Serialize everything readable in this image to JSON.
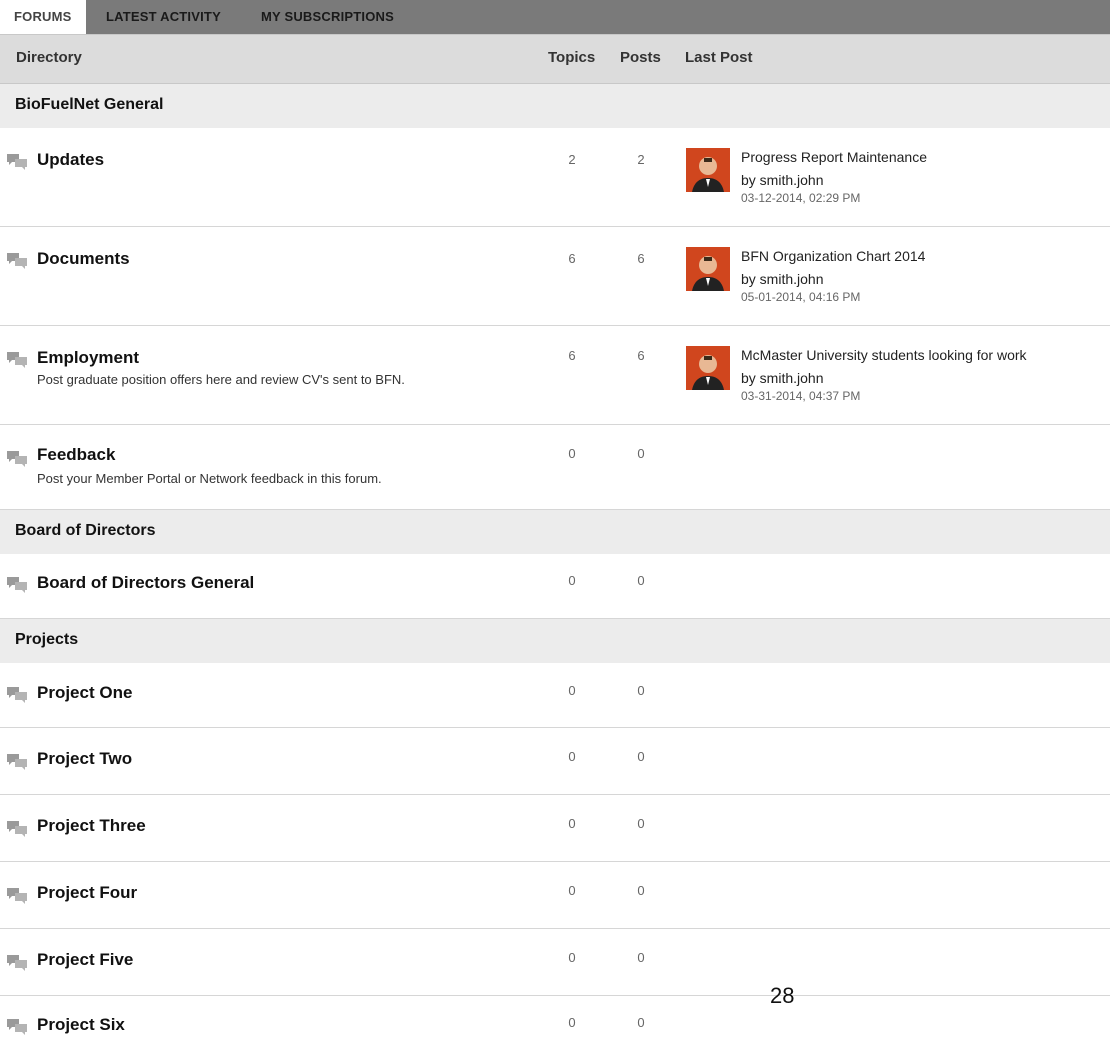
{
  "tabs": [
    "FORUMS",
    "LATEST ACTIVITY",
    "MY SUBSCRIPTIONS"
  ],
  "columns": {
    "directory": "Directory",
    "topics": "Topics",
    "posts": "Posts",
    "last_post": "Last Post"
  },
  "categories": [
    {
      "name": "BioFuelNet General"
    },
    {
      "name": "Board of Directors"
    },
    {
      "name": "Projects"
    }
  ],
  "forums": [
    {
      "title": "Updates",
      "desc": "",
      "topics": "2",
      "posts": "2",
      "last_post": {
        "title": "Progress Report Maintenance",
        "by": "by smith.john",
        "date": "03-12-2014, 02:29 PM"
      }
    },
    {
      "title": "Documents",
      "desc": "",
      "topics": "6",
      "posts": "6",
      "last_post": {
        "title": "BFN Organization Chart 2014",
        "by": "by smith.john",
        "date": "05-01-2014, 04:16 PM"
      }
    },
    {
      "title": "Employment",
      "desc": "Post graduate position offers here and review CV's sent to BFN.",
      "topics": "6",
      "posts": "6",
      "last_post": {
        "title": "McMaster University students looking for work",
        "by": "by smith.john",
        "date": "03-31-2014, 04:37 PM"
      }
    },
    {
      "title": "Feedback",
      "desc": "Post your Member Portal or Network feedback in this forum.",
      "topics": "0",
      "posts": "0"
    },
    {
      "title": "Board of Directors General",
      "desc": "",
      "topics": "0",
      "posts": "0"
    },
    {
      "title": "Project One",
      "desc": "",
      "topics": "0",
      "posts": "0"
    },
    {
      "title": "Project Two",
      "desc": "",
      "topics": "0",
      "posts": "0"
    },
    {
      "title": "Project Three",
      "desc": "",
      "topics": "0",
      "posts": "0"
    },
    {
      "title": "Project Four",
      "desc": "",
      "topics": "0",
      "posts": "0"
    },
    {
      "title": "Project Five",
      "desc": "",
      "topics": "0",
      "posts": "0"
    },
    {
      "title": "Project Six",
      "desc": "",
      "topics": "0",
      "posts": "0"
    }
  ],
  "page_number": "28",
  "icons": {
    "forum": "speech-bubbles-icon",
    "avatar": "user-avatar"
  },
  "colors": {
    "tab_bar": "#7a7a7a",
    "header_bg": "#dcdcdc",
    "category_bg": "#ececec",
    "avatar_bg": "#d0461e"
  }
}
